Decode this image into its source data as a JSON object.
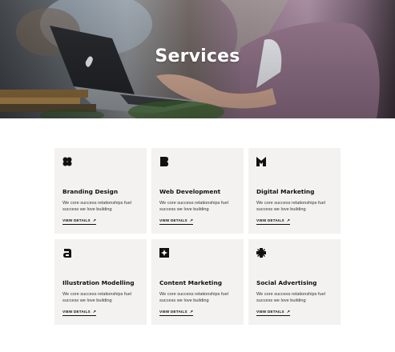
{
  "hero": {
    "title": "Services"
  },
  "services": [
    {
      "title": "Branding Design",
      "icon": "clover-icon",
      "desc": "We core success relationships fuel success we love building",
      "link": "VIEW DETAILS",
      "arrow": "↗"
    },
    {
      "title": "Web Development",
      "icon": "b-shape-icon",
      "desc": "We core success relationships fuel success we love building",
      "link": "VIEW DETAILS",
      "arrow": "↗"
    },
    {
      "title": "Digital Marketing",
      "icon": "m-shape-icon",
      "desc": "We core success relationships fuel success we love building",
      "link": "VIEW DETAILS",
      "arrow": "↗"
    },
    {
      "title": "Illustration Modelling",
      "icon": "a-shape-icon",
      "desc": "We core success relationships fuel success we love building",
      "link": "VIEW DETAILS",
      "arrow": "↗"
    },
    {
      "title": "Content Marketing",
      "icon": "star-square-icon",
      "desc": "We core success relationships fuel success we love building",
      "link": "VIEW DETAILS",
      "arrow": "↗"
    },
    {
      "title": "Social Advertising",
      "icon": "cross-flower-icon",
      "desc": "We core success relationships fuel success we love building",
      "link": "VIEW DETAILS",
      "arrow": "↗"
    }
  ],
  "colors": {
    "card_bg": "#f3f2f0",
    "text": "#111111",
    "hero_text": "#ffffff"
  }
}
